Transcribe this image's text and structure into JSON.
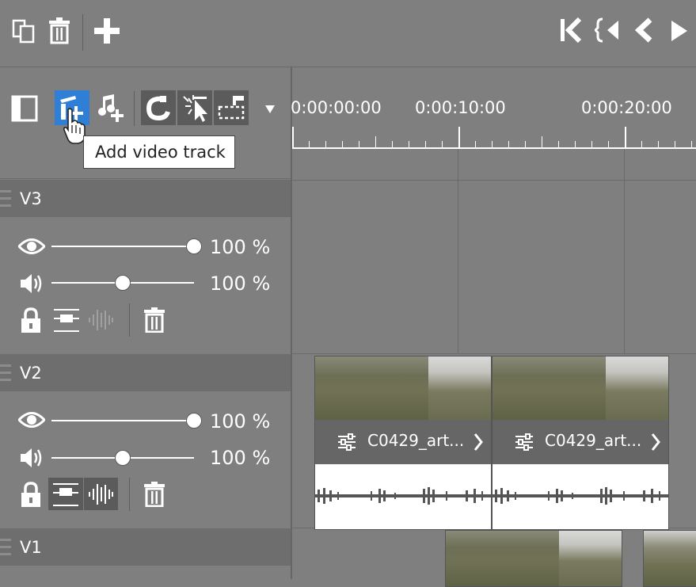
{
  "toolbar_top": {
    "icons": [
      "copy-icon",
      "trash-icon",
      "add-icon",
      "go-to-start-icon",
      "prev-marker-icon",
      "prev-frame-icon",
      "play-icon"
    ]
  },
  "track_toolbar": {
    "icons": [
      "toggle-panel-icon",
      "add-video-track-icon",
      "add-audio-track-icon",
      "magnet-snap-icon",
      "select-tool-icon",
      "trim-tool-icon",
      "dropdown-icon"
    ],
    "tooltip": "Add video track"
  },
  "ruler": {
    "labels": [
      "0:00:00:00",
      "0:00:10:00",
      "0:00:20:00"
    ]
  },
  "tracks": [
    {
      "name": "V3",
      "opacity": "100",
      "volume": "100",
      "opacity_unit": "%",
      "volume_unit": "%",
      "opacity_level": 1.0,
      "volume_level": 0.5
    },
    {
      "name": "V2",
      "opacity": "100",
      "volume": "100",
      "opacity_unit": "%",
      "volume_unit": "%",
      "opacity_level": 1.0,
      "volume_level": 0.5
    },
    {
      "name": "V1"
    }
  ],
  "clips": [
    {
      "track": "V2",
      "name": "C0429_art..."
    },
    {
      "track": "V2",
      "name": "C0429_art..."
    }
  ],
  "colors": {
    "background": "#7f7f7f",
    "track_header": "#6e6e6e",
    "accent": "#2f7fd6",
    "active_button": "#5b5b5b"
  }
}
